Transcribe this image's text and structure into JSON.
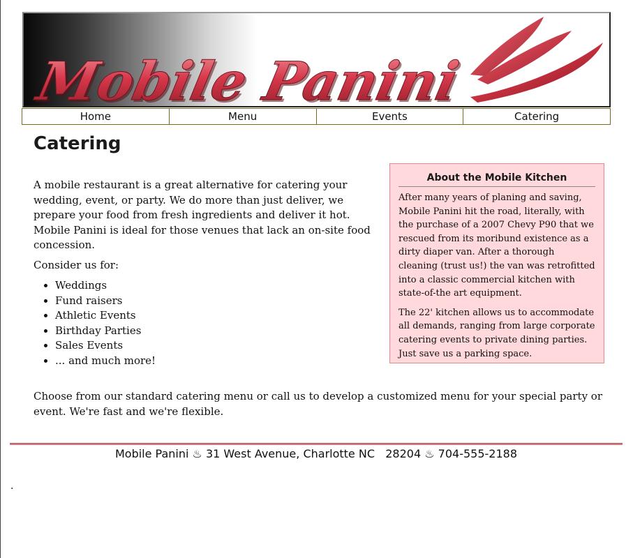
{
  "banner": {
    "logo_text": "Mobile Panini",
    "colors": {
      "logo_red": "#d6374a",
      "logo_dark_red": "#8e1d28",
      "gradient_dark": "#080808",
      "gradient_light": "#ffffff"
    }
  },
  "nav": {
    "items": [
      {
        "label": "Home"
      },
      {
        "label": "Menu"
      },
      {
        "label": "Events"
      },
      {
        "label": "Catering"
      }
    ],
    "border_color": "#7a6a1e"
  },
  "main": {
    "title": "Catering",
    "intro": "A mobile restaurant is a great alternative for catering your wedding, event, or party. We do more than just deliver, we prepare your food from fresh ingredients and deliver it hot. Mobile Panini is ideal for those venues that lack an on-site food concession.",
    "consider_label": "Consider us for:",
    "uses": [
      "Weddings",
      "Fund raisers",
      "Athletic Events",
      "Birthday Parties",
      "Sales Events",
      "... and much more!"
    ],
    "closing": "Choose from our standard catering menu or call us to develop a customized menu for your special party or event. We're fast and we're flexible."
  },
  "sidebar": {
    "title": "About the Mobile Kitchen",
    "paragraphs": [
      "After many years of planing and saving, Mobile Panini hit the road, literally, with the purchase of a 2007 Chevy P90 that we rescued from its moribund existence as a dirty diaper van. After a thorough cleaning (trust us!) the van was retrofitted into a classic commercial kitchen with state-of-the art equipment.",
      "The 22' kitchen allows us to accommodate all demands, ranging from large corporate catering events to private dining parties. Just save us a parking space."
    ],
    "background": "#ffd9dc",
    "border_color": "#e28a90"
  },
  "footer": {
    "text": "Mobile Panini ♨ 31 West Avenue, Charlotte NC   28204 ♨ 704-555-2188",
    "rule_color": "#d9767c"
  },
  "stray_mark": "."
}
